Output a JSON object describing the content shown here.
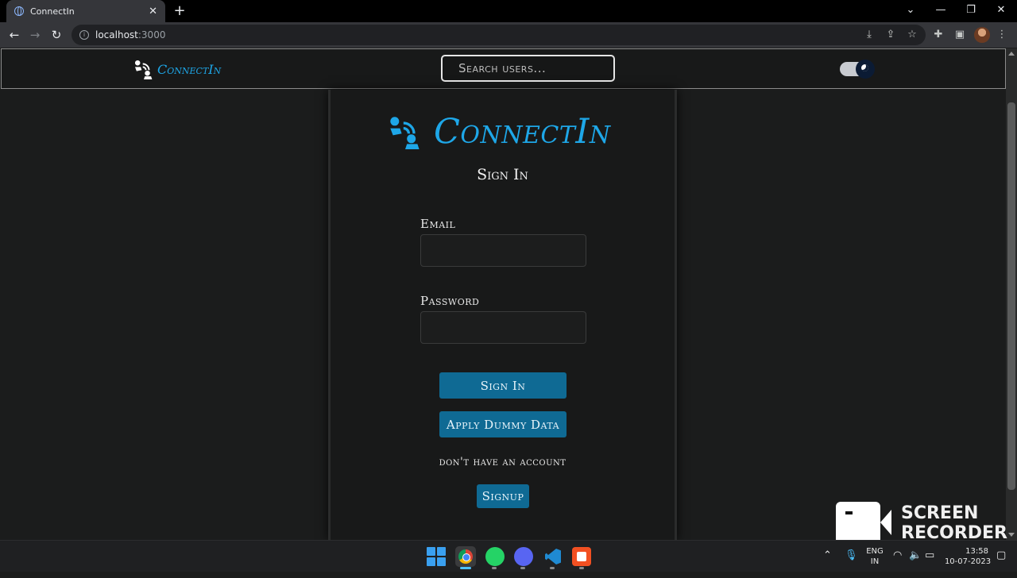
{
  "browser": {
    "tab_title": "ConnectIn",
    "tab_close": "✕",
    "new_tab": "+",
    "url_host": "localhost",
    "url_port": ":3000",
    "window_controls": {
      "chevron": "⌄",
      "minimize": "—",
      "restore": "❐",
      "close": "✕"
    }
  },
  "header": {
    "brand": "ConnectIn",
    "search_placeholder": "Search users...",
    "theme_toggle": "dark"
  },
  "login": {
    "brand": "ConnectIn",
    "title": "Sign In",
    "email_label": "Email",
    "email_value": "",
    "password_label": "Password",
    "password_value": "",
    "signin_button": "Sign In",
    "dummy_button": "Apply Dummy Data",
    "account_prompt": "don't have an account",
    "signup_button": "Signup"
  },
  "recorder": {
    "line1": "SCREEN",
    "line2": "RECORDER"
  },
  "taskbar": {
    "lang_top": "ENG",
    "lang_bottom": "IN",
    "time": "13:58",
    "date": "10-07-2023"
  },
  "colors": {
    "accent": "#1ea7e8",
    "button": "#0f6a94",
    "background": "#1b1c1c"
  }
}
